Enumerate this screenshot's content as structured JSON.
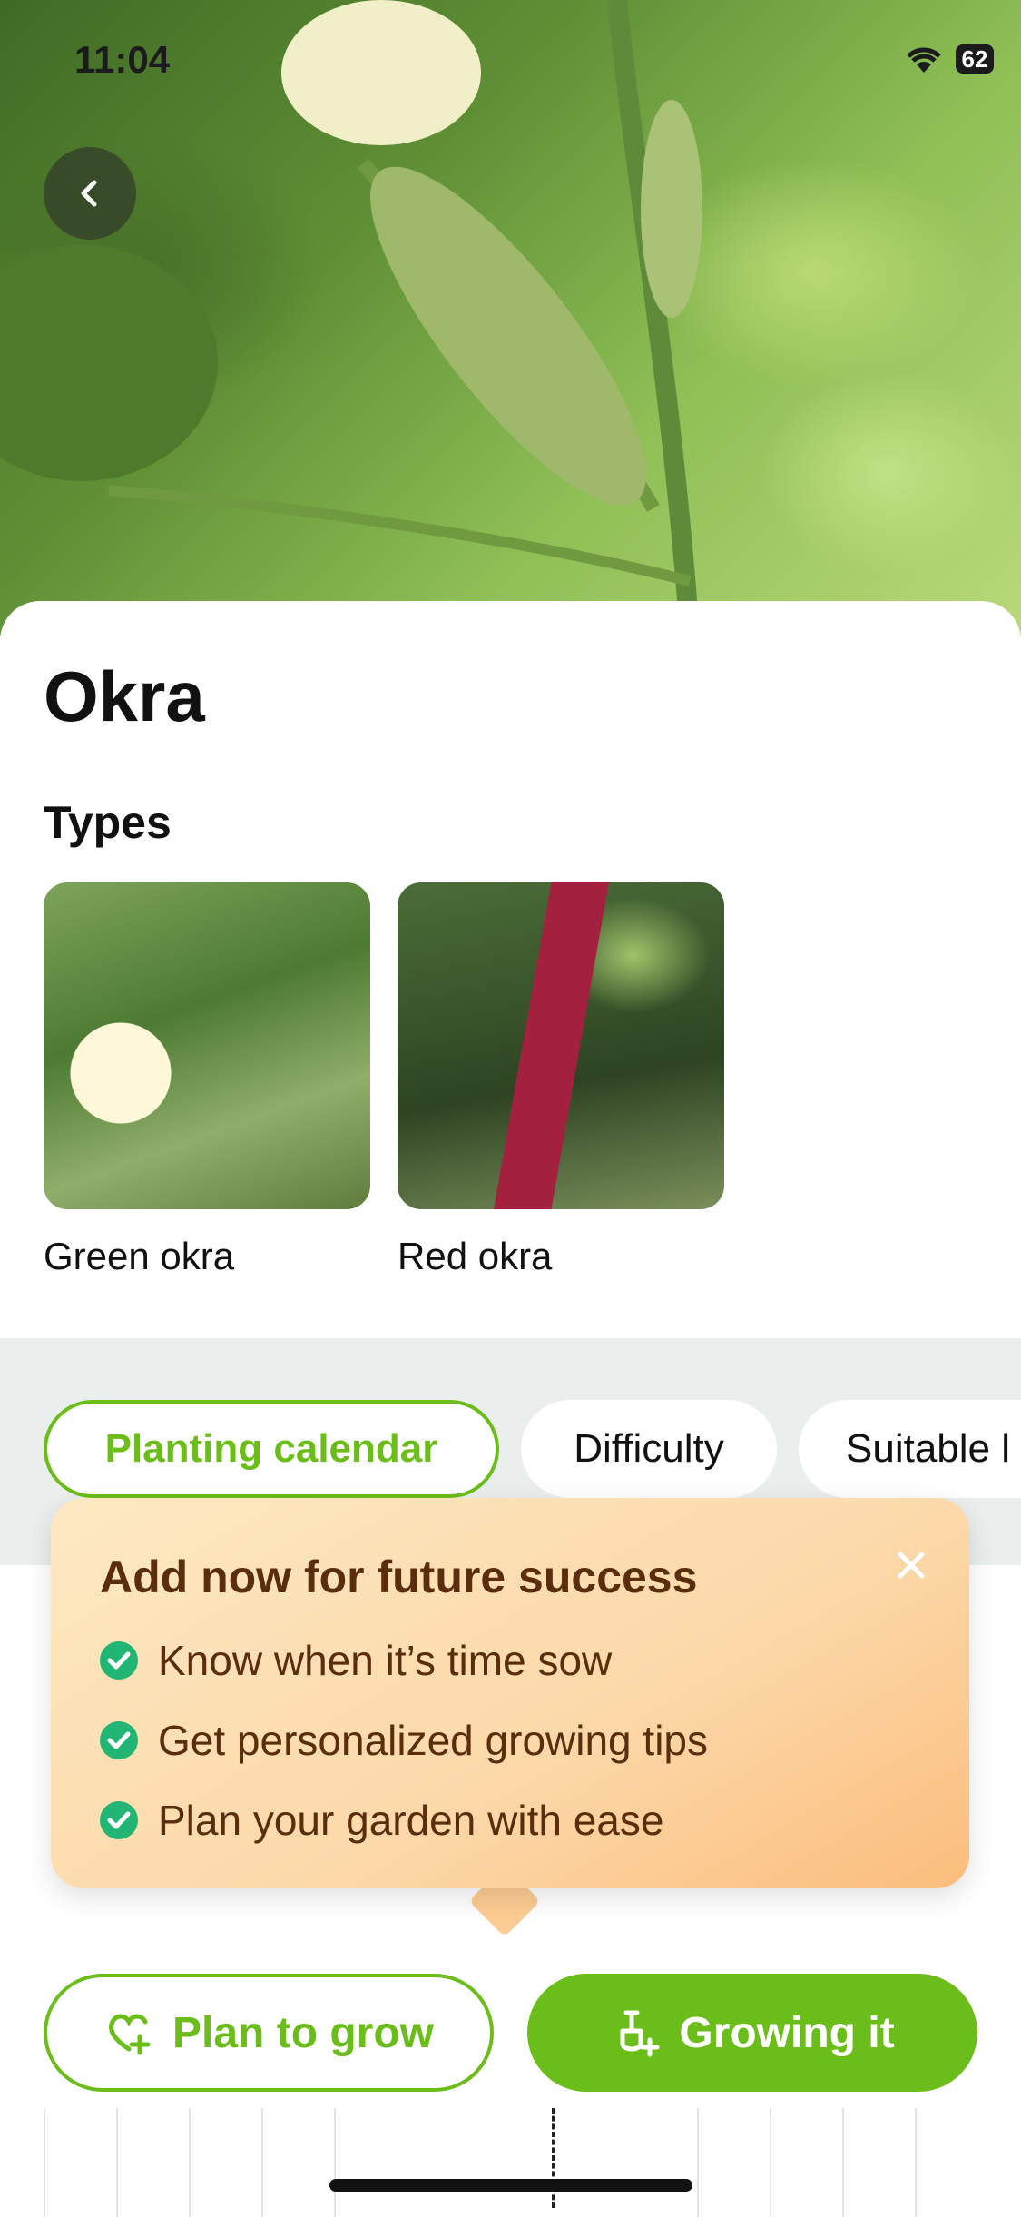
{
  "status_bar": {
    "time": "11:04",
    "battery": "62"
  },
  "plant": {
    "name": "Okra"
  },
  "types": {
    "heading": "Types",
    "items": [
      {
        "label": "Green okra"
      },
      {
        "label": "Red okra"
      }
    ]
  },
  "tabs": [
    {
      "label": "Planting calendar",
      "active": true
    },
    {
      "label": "Difficulty",
      "active": false
    },
    {
      "label": "Suitable l",
      "active": false
    }
  ],
  "popup": {
    "title": "Add now for future success",
    "benefits": [
      "Know when it’s time sow",
      "Get personalized growing tips",
      "Plan your garden with ease"
    ]
  },
  "actions": {
    "plan_label": "Plan to grow",
    "growing_label": "Growing it"
  },
  "colors": {
    "accent": "#6bbd1a",
    "popup_text": "#5a2d0c",
    "check": "#22b573"
  },
  "icons": [
    "back-chevron-icon",
    "wifi-icon",
    "battery-icon",
    "close-icon",
    "check-circle-icon",
    "heart-plus-icon",
    "shovel-plus-icon"
  ]
}
